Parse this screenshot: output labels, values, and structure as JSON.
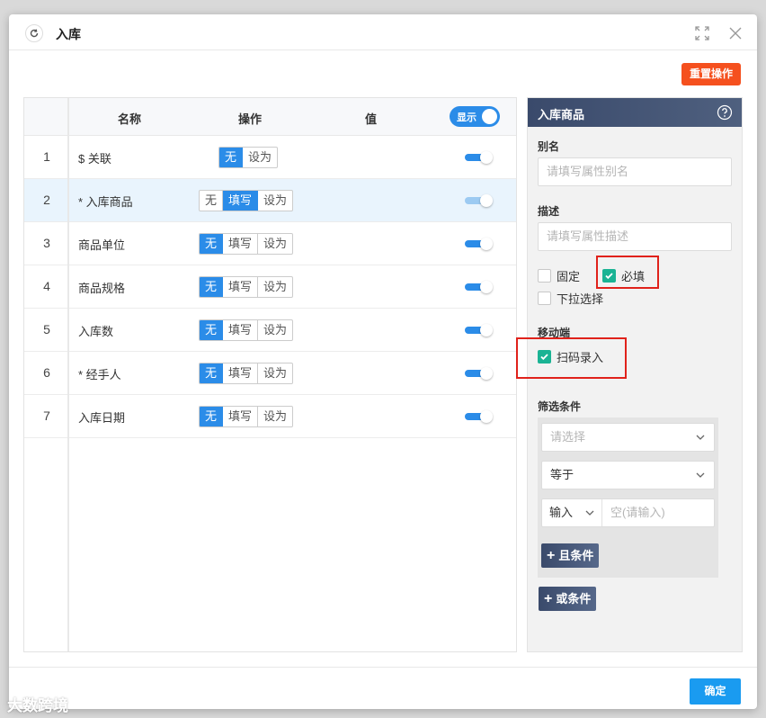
{
  "dialog": {
    "title": "入库",
    "reset_label": "重置操作",
    "ok_label": "确定"
  },
  "table": {
    "headers": {
      "name": "名称",
      "op": "操作",
      "value": "值",
      "show": "显示"
    },
    "rows": [
      {
        "index": "1",
        "name": "$ 关联",
        "options": [
          "无",
          "设为"
        ],
        "active": "无"
      },
      {
        "index": "2",
        "name": "* 入库商品",
        "options": [
          "无",
          "填写",
          "设为"
        ],
        "active": "填写"
      },
      {
        "index": "3",
        "name": "商品单位",
        "options": [
          "无",
          "填写",
          "设为"
        ],
        "active": "无"
      },
      {
        "index": "4",
        "name": "商品规格",
        "options": [
          "无",
          "填写",
          "设为"
        ],
        "active": "无"
      },
      {
        "index": "5",
        "name": "入库数",
        "options": [
          "无",
          "填写",
          "设为"
        ],
        "active": "无"
      },
      {
        "index": "6",
        "name": "* 经手人",
        "options": [
          "无",
          "填写",
          "设为"
        ],
        "active": "无"
      },
      {
        "index": "7",
        "name": "入库日期",
        "options": [
          "无",
          "填写",
          "设为"
        ],
        "active": "无"
      }
    ]
  },
  "props": {
    "header": "入库商品",
    "alias_label": "别名",
    "alias_placeholder": "请填写属性别名",
    "desc_label": "描述",
    "desc_placeholder": "请填写属性描述",
    "fixed_label": "固定",
    "required_label": "必填",
    "dropdown_label": "下拉选择",
    "mobile_label": "移动端",
    "scan_label": "扫码录入",
    "filter_label": "筛选条件",
    "filter_select_placeholder": "请选择",
    "operator_value": "等于",
    "input_type": "输入",
    "input_placeholder": "空(请输入)",
    "and_label": "且条件",
    "or_label": "或条件"
  },
  "watermark": "大数跨境",
  "colors": {
    "accent": "#2b8ce8",
    "danger": "#f5501e",
    "check": "#1ab394",
    "header_dark": "#3a4a6b"
  }
}
